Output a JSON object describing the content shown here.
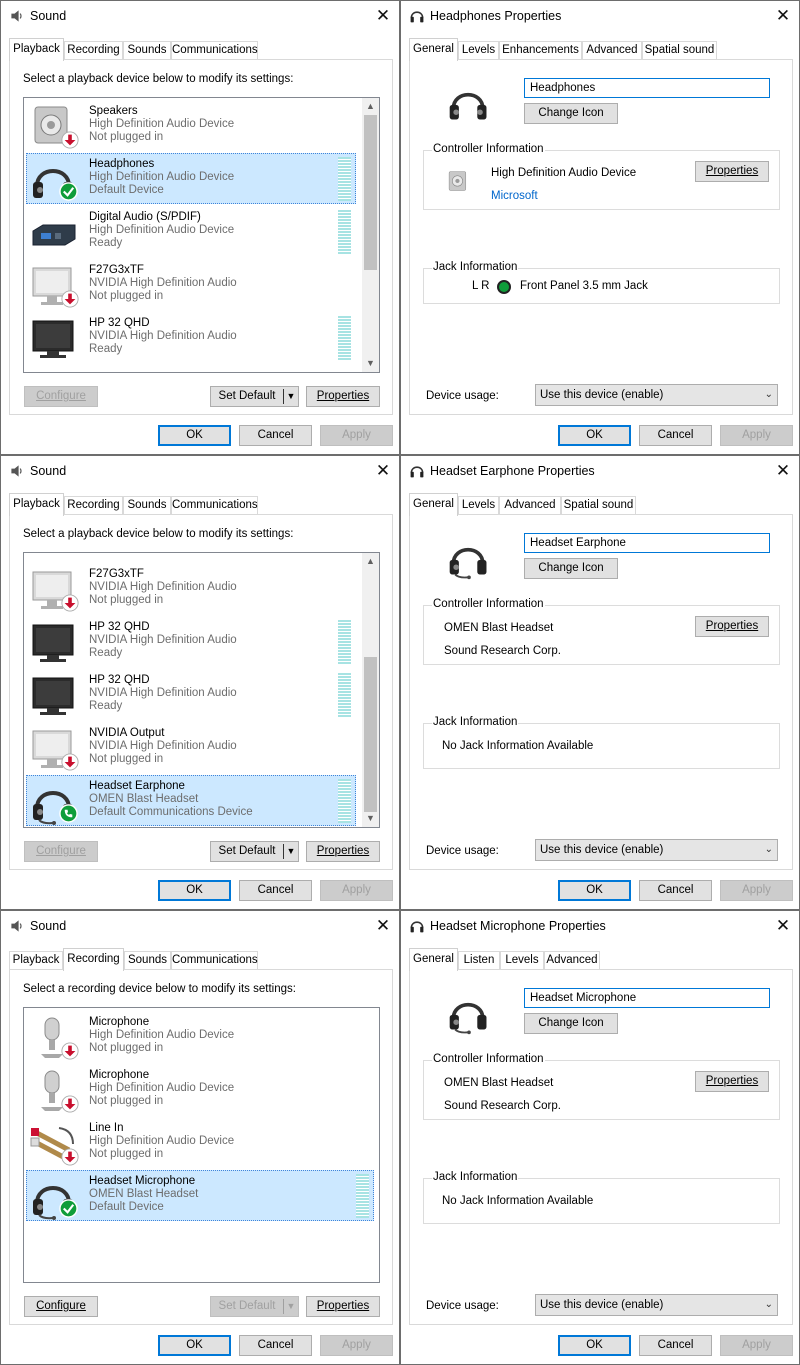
{
  "sound1": {
    "title": "Sound",
    "tabs": [
      "Playback",
      "Recording",
      "Sounds",
      "Communications"
    ],
    "instruction": "Select a playback device below to modify its settings:",
    "devices": [
      {
        "name": "Speakers",
        "desc": "High Definition Audio Device",
        "status": "Not plugged in"
      },
      {
        "name": "Headphones",
        "desc": "High Definition Audio Device",
        "status": "Default Device"
      },
      {
        "name": "Digital Audio (S/PDIF)",
        "desc": "High Definition Audio Device",
        "status": "Ready"
      },
      {
        "name": "F27G3xTF",
        "desc": "NVIDIA High Definition Audio",
        "status": "Not plugged in"
      },
      {
        "name": "HP 32 QHD",
        "desc": "NVIDIA High Definition Audio",
        "status": "Ready"
      }
    ],
    "configure": "Configure",
    "set_default": "Set Default",
    "properties": "Properties",
    "ok": "OK",
    "cancel": "Cancel",
    "apply": "Apply"
  },
  "sound2": {
    "title": "Sound",
    "tabs": [
      "Playback",
      "Recording",
      "Sounds",
      "Communications"
    ],
    "instruction": "Select a playback device below to modify its settings:",
    "devices": [
      {
        "name": "F27G3xTF",
        "desc": "NVIDIA High Definition Audio",
        "status": "Not plugged in"
      },
      {
        "name": "HP 32 QHD",
        "desc": "NVIDIA High Definition Audio",
        "status": "Ready"
      },
      {
        "name": "HP 32 QHD",
        "desc": "NVIDIA High Definition Audio",
        "status": "Ready"
      },
      {
        "name": "NVIDIA Output",
        "desc": "NVIDIA High Definition Audio",
        "status": "Not plugged in"
      },
      {
        "name": "Headset Earphone",
        "desc": "OMEN Blast Headset",
        "status": "Default Communications Device"
      }
    ],
    "configure": "Configure",
    "set_default": "Set Default",
    "properties": "Properties",
    "ok": "OK",
    "cancel": "Cancel",
    "apply": "Apply"
  },
  "sound3": {
    "title": "Sound",
    "tabs": [
      "Playback",
      "Recording",
      "Sounds",
      "Communications"
    ],
    "instruction": "Select a recording device below to modify its settings:",
    "devices": [
      {
        "name": "Microphone",
        "desc": "High Definition Audio Device",
        "status": "Not plugged in"
      },
      {
        "name": "Microphone",
        "desc": "High Definition Audio Device",
        "status": "Not plugged in"
      },
      {
        "name": "Line In",
        "desc": "High Definition Audio Device",
        "status": "Not plugged in"
      },
      {
        "name": "Headset Microphone",
        "desc": "OMEN Blast Headset",
        "status": "Default Device"
      }
    ],
    "configure": "Configure",
    "set_default": "Set Default",
    "properties": "Properties",
    "ok": "OK",
    "cancel": "Cancel",
    "apply": "Apply"
  },
  "props1": {
    "title": "Headphones Properties",
    "tabs": [
      "General",
      "Levels",
      "Enhancements",
      "Advanced",
      "Spatial sound"
    ],
    "name_value": "Headphones",
    "change_icon": "Change Icon",
    "controller_label": "Controller Information",
    "controller_name": "High Definition Audio Device",
    "controller_vendor": "Microsoft",
    "properties": "Properties",
    "jack_label": "Jack Information",
    "jack_lr": "L R",
    "jack_name": "Front Panel 3.5 mm Jack",
    "usage_label": "Device usage:",
    "usage_value": "Use this device (enable)",
    "ok": "OK",
    "cancel": "Cancel",
    "apply": "Apply"
  },
  "props2": {
    "title": "Headset Earphone Properties",
    "tabs": [
      "General",
      "Levels",
      "Advanced",
      "Spatial sound"
    ],
    "name_value": "Headset Earphone",
    "change_icon": "Change Icon",
    "controller_label": "Controller Information",
    "controller_name": "OMEN Blast Headset",
    "controller_vendor": "Sound Research Corp.",
    "properties": "Properties",
    "jack_label": "Jack Information",
    "jack_text": "No Jack Information Available",
    "usage_label": "Device usage:",
    "usage_value": "Use this device (enable)",
    "ok": "OK",
    "cancel": "Cancel",
    "apply": "Apply"
  },
  "props3": {
    "title": "Headset Microphone Properties",
    "tabs": [
      "General",
      "Listen",
      "Levels",
      "Advanced"
    ],
    "name_value": "Headset Microphone",
    "change_icon": "Change Icon",
    "controller_label": "Controller Information",
    "controller_name": "OMEN Blast Headset",
    "controller_vendor": "Sound Research Corp.",
    "properties": "Properties",
    "jack_label": "Jack Information",
    "jack_text": "No Jack Information Available",
    "usage_label": "Device usage:",
    "usage_value": "Use this device (enable)",
    "ok": "OK",
    "cancel": "Cancel",
    "apply": "Apply"
  }
}
